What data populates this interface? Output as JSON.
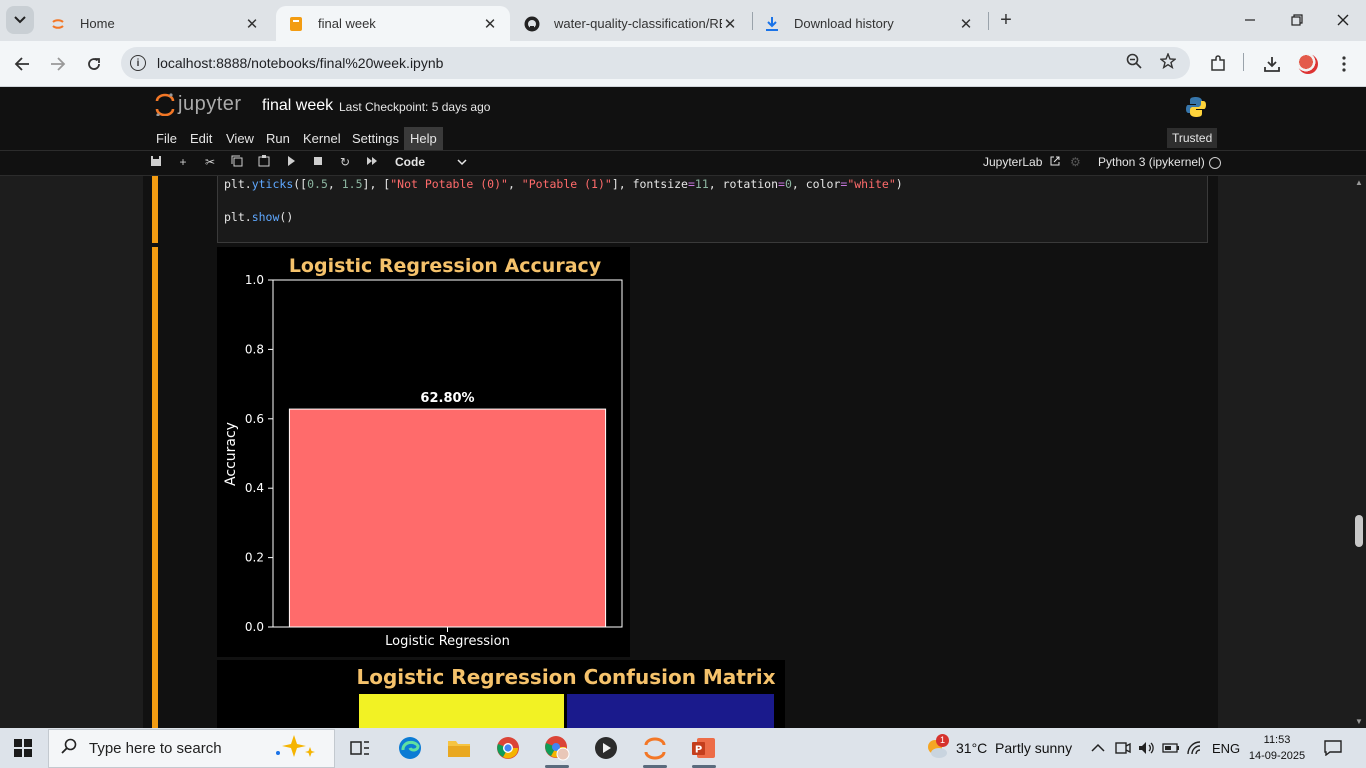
{
  "browser": {
    "tabs": [
      {
        "label": "Home",
        "icon": "jupyter-icon",
        "active": false
      },
      {
        "label": "final week",
        "icon": "notebook-icon",
        "active": true
      },
      {
        "label": "water-quality-classification/REA",
        "icon": "github-icon",
        "active": false
      },
      {
        "label": "Download history",
        "icon": "download-icon",
        "active": false
      }
    ],
    "url": "localhost:8888/notebooks/final%20week.ipynb"
  },
  "jupyter": {
    "logo_text": "jupyter",
    "notebook_title": "final week",
    "checkpoint": "Last Checkpoint: 5 days ago",
    "menu": [
      "File",
      "Edit",
      "View",
      "Run",
      "Kernel",
      "Settings",
      "Help"
    ],
    "trusted": "Trusted",
    "cell_type": "Code",
    "jupyterlab_link": "JupyterLab",
    "kernel": "Python 3 (ipykernel)"
  },
  "code_cell": {
    "lines": [
      "plt.yticks([0.5, 1.5], [\"Not Potable (0)\", \"Potable (1)\"], fontsize=11, rotation=0, color=\"white\")",
      "",
      "plt.show()"
    ]
  },
  "chart_data": [
    {
      "type": "bar",
      "title": "Logistic Regression Accuracy",
      "categories": [
        "Logistic Regression"
      ],
      "values": [
        0.628
      ],
      "data_labels": [
        "62.80%"
      ],
      "ylabel": "Accuracy",
      "xlabel": "",
      "ylim": [
        0,
        1.0
      ],
      "yticks": [
        "0.0",
        "0.2",
        "0.4",
        "0.6",
        "0.8",
        "1.0"
      ],
      "bar_color": "#ff6b6b",
      "title_color": "#f5c26b",
      "background": "#000000"
    },
    {
      "type": "heatmap",
      "title": "Logistic Regression Confusion Matrix",
      "title_color": "#f5c26b",
      "visible_cells_colors": [
        "#f2f224",
        "#1a1a8c"
      ]
    }
  ],
  "taskbar": {
    "search_placeholder": "Type here to search",
    "weather": "31°C  Partly sunny",
    "weather_badge": "1",
    "language": "ENG",
    "time": "11:53",
    "date": "14-09-2025"
  }
}
